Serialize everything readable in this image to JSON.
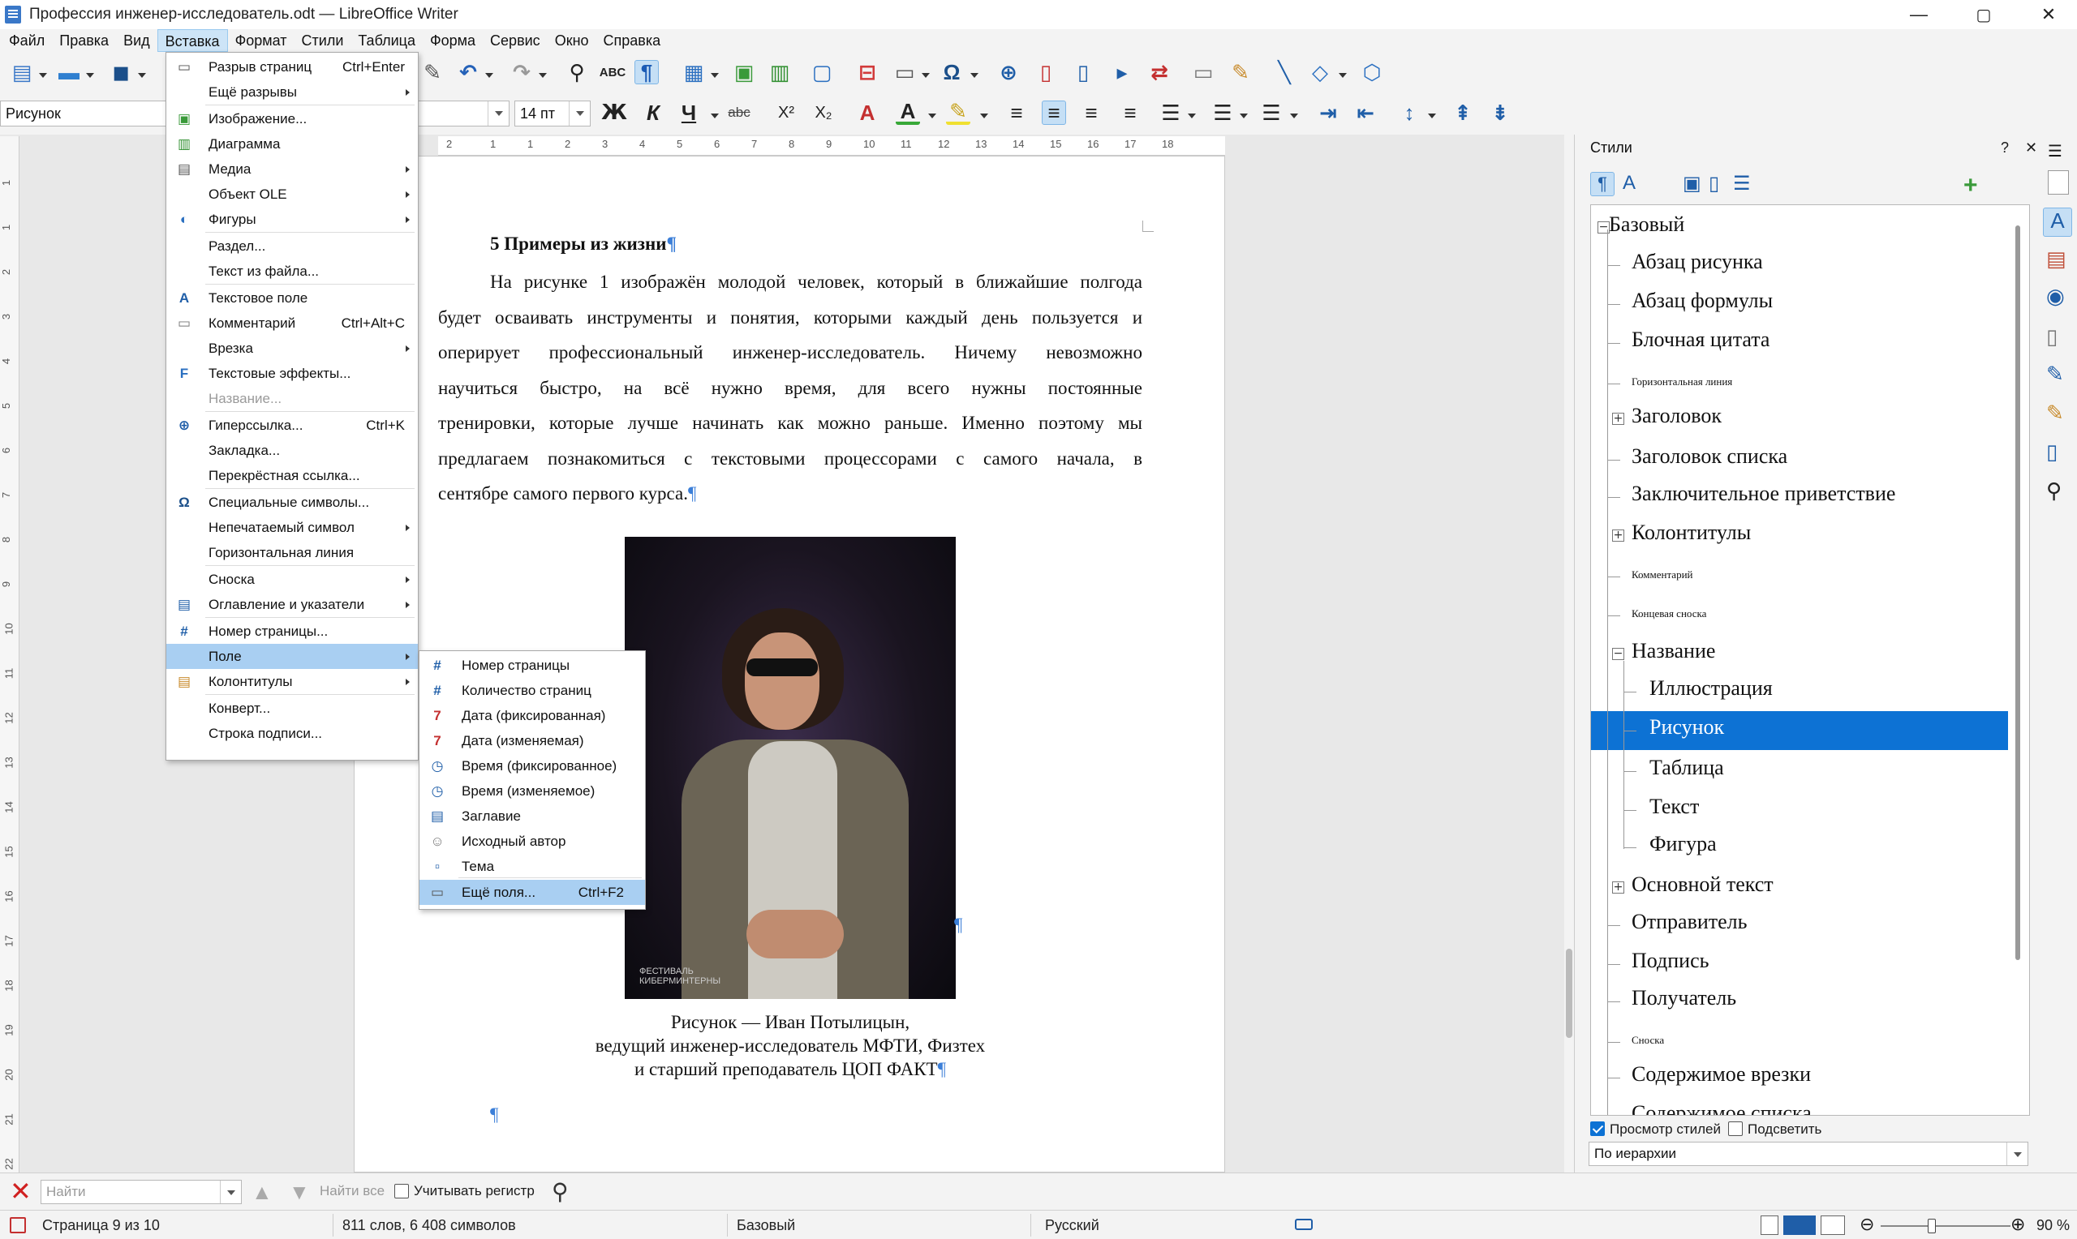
{
  "window": {
    "title": "Профессия инженер-исследователь.odt — LibreOffice Writer",
    "minimize": "—",
    "maximize": "▢",
    "close": "✕"
  },
  "menubar": [
    "Файл",
    "Правка",
    "Вид",
    "Вставка",
    "Формат",
    "Стили",
    "Таблица",
    "Форма",
    "Сервис",
    "Окно",
    "Справка"
  ],
  "toolbar": {
    "style_name": "Рисунок",
    "font_size": "14 пт",
    "bold": "Ж",
    "italic": "К",
    "underline": "Ч",
    "strike": "abc",
    "superscript": "X²",
    "subscript": "X₂"
  },
  "ruler": {
    "marks": [
      "2",
      "1",
      "1",
      "2",
      "3",
      "4",
      "5",
      "6",
      "7",
      "8",
      "9",
      "10",
      "11",
      "12",
      "13",
      "14",
      "15",
      "16",
      "17",
      "18"
    ],
    "vmarks": [
      "1",
      "1",
      "2",
      "3",
      "4",
      "5",
      "6",
      "7",
      "8",
      "9",
      "10",
      "11",
      "12",
      "13",
      "14",
      "15",
      "16",
      "17",
      "18",
      "19",
      "20",
      "21",
      "22"
    ]
  },
  "document": {
    "heading": "5 Примеры из жизни",
    "lines": [
      "На рисунке 1 изображён молодой человек, который в ближайшие полгода",
      "будет осваивать инструменты и понятия, которыми каждый день пользуется и",
      "оперирует профессиональный инженер-исследователь. Ничему невозможно",
      "научиться быстро, на всё нужно время, для всего нужны постоянные",
      "тренировки, которые лучше начинать как можно раньше. Именно поэтому мы",
      "предлагаем познакомиться с текстовыми процессорами с самого начала, в",
      "сентябре самого первого курса."
    ],
    "caption": [
      "Рисунок — Иван Потылицын,",
      "ведущий инженер-исследователь МФТИ, Физтех",
      "и старший преподаватель ЦОП ФАКТ"
    ],
    "watermark": [
      "ФЕСТИВАЛЬ",
      "КИБЕРМИНТЕРНЫ"
    ],
    "pilcrow": "¶"
  },
  "insert_menu": {
    "items": [
      {
        "label": "Разрыв страниц",
        "shortcut": "Ctrl+Enter",
        "icon": "page-break-icon"
      },
      {
        "label": "Ещё разрывы",
        "submenu": true
      },
      {
        "label": "Изображение...",
        "icon": "image-icon"
      },
      {
        "label": "Диаграмма",
        "icon": "chart-icon"
      },
      {
        "label": "Медиа",
        "submenu": true,
        "icon": "media-icon"
      },
      {
        "label": "Объект OLE",
        "submenu": true
      },
      {
        "label": "Фигуры",
        "submenu": true,
        "icon": "shapes-icon"
      },
      {
        "label": "Раздел..."
      },
      {
        "label": "Текст из файла..."
      },
      {
        "label": "Текстовое поле",
        "icon": "textbox-icon"
      },
      {
        "label": "Комментарий",
        "shortcut": "Ctrl+Alt+C",
        "icon": "comment-icon"
      },
      {
        "label": "Врезка",
        "submenu": true
      },
      {
        "label": "Текстовые эффекты...",
        "icon": "fontwork-icon"
      },
      {
        "label": "Название...",
        "disabled": true
      },
      {
        "label": "Гиперссылка...",
        "shortcut": "Ctrl+K",
        "icon": "hyperlink-icon"
      },
      {
        "label": "Закладка..."
      },
      {
        "label": "Перекрёстная ссылка..."
      },
      {
        "label": "Специальные символы...",
        "icon": "omega-icon"
      },
      {
        "label": "Непечатаемый символ",
        "submenu": true
      },
      {
        "label": "Горизонтальная линия"
      },
      {
        "label": "Сноска",
        "submenu": true
      },
      {
        "label": "Оглавление и указатели",
        "submenu": true,
        "icon": "toc-icon"
      },
      {
        "label": "Номер страницы...",
        "icon": "hash-icon"
      },
      {
        "label": "Поле",
        "submenu": true,
        "highlighted": true
      },
      {
        "label": "Колонтитулы",
        "submenu": true,
        "icon": "header-footer-icon"
      },
      {
        "label": "Конверт..."
      },
      {
        "label": "Строка подписи..."
      }
    ]
  },
  "field_submenu": {
    "items": [
      {
        "label": "Номер страницы",
        "icon": "hash-icon"
      },
      {
        "label": "Количество страниц",
        "icon": "hash-icon"
      },
      {
        "label": "Дата (фиксированная)",
        "icon": "calendar-icon"
      },
      {
        "label": "Дата (изменяемая)",
        "icon": "calendar-icon"
      },
      {
        "label": "Время (фиксированное)",
        "icon": "clock-icon"
      },
      {
        "label": "Время (изменяемое)",
        "icon": "clock-icon"
      },
      {
        "label": "Заглавие",
        "icon": "doc-icon"
      },
      {
        "label": "Исходный автор",
        "icon": "person-icon"
      },
      {
        "label": "Тема",
        "icon": "topic-icon"
      },
      {
        "label": "Ещё поля...",
        "shortcut": "Ctrl+F2",
        "icon": "more-fields-icon",
        "highlighted": true
      }
    ]
  },
  "sidebar": {
    "title": "Стили",
    "help": "?",
    "close": "✕",
    "styles": [
      {
        "label": "Базовый",
        "level": 0,
        "exp": "−"
      },
      {
        "label": "Абзац рисунка",
        "level": 1
      },
      {
        "label": "Абзац формулы",
        "level": 1
      },
      {
        "label": "Блочная цитата",
        "level": 1
      },
      {
        "label": "Горизонтальная линия",
        "level": 1,
        "small": true
      },
      {
        "label": "Заголовок",
        "level": 1,
        "exp": "+"
      },
      {
        "label": "Заголовок списка",
        "level": 1
      },
      {
        "label": "Заключительное приветствие",
        "level": 1
      },
      {
        "label": "Колонтитулы",
        "level": 1,
        "exp": "+"
      },
      {
        "label": "Комментарий",
        "level": 1,
        "small": true
      },
      {
        "label": "Концевая сноска",
        "level": 1,
        "small": true
      },
      {
        "label": "Название",
        "level": 1,
        "exp": "−"
      },
      {
        "label": "Иллюстрация",
        "level": 2
      },
      {
        "label": "Рисунок",
        "level": 2,
        "selected": true
      },
      {
        "label": "Таблица",
        "level": 2
      },
      {
        "label": "Текст",
        "level": 2
      },
      {
        "label": "Фигура",
        "level": 2
      },
      {
        "label": "Основной текст",
        "level": 1,
        "exp": "+"
      },
      {
        "label": "Отправитель",
        "level": 1
      },
      {
        "label": "Подпись",
        "level": 1
      },
      {
        "label": "Получатель",
        "level": 1
      },
      {
        "label": "Сноска",
        "level": 1,
        "small": true
      },
      {
        "label": "Содержимое врезки",
        "level": 1
      },
      {
        "label": "Содержимое списка",
        "level": 1
      }
    ],
    "preview_label": "Просмотр стилей",
    "highlight_label": "Подсветить",
    "filter": "По иерархии"
  },
  "findbar": {
    "placeholder": "Найти",
    "find_all": "Найти все",
    "match_case": "Учитывать регистр"
  },
  "statusbar": {
    "page": "Страница 9 из 10",
    "words": "811 слов, 6 408 символов",
    "style": "Базовый",
    "lang": "Русский",
    "zoom": "90 %"
  },
  "colors": {
    "accent": "#0d72d4",
    "menu_highlight": "#a9cff2",
    "pilcrow": "#3c7fd8"
  }
}
